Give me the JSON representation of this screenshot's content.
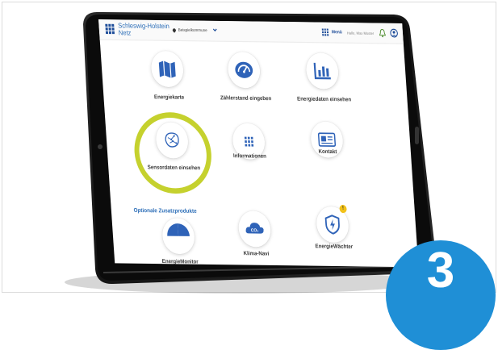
{
  "app": {
    "brand_line1": "Schleswig-Holstein",
    "brand_line2": "Netz",
    "location_label": "Beispielkommune",
    "menu_label": "Menü",
    "greeting": "Hallo, Max Muster"
  },
  "tiles": [
    {
      "label": "Energiekarte",
      "icon": "map-icon"
    },
    {
      "label": "Zählerstand eingeben",
      "icon": "gauge-icon"
    },
    {
      "label": "Energiedaten einsehen",
      "icon": "bar-chart-icon"
    },
    {
      "label": "Sensordaten einsehen",
      "icon": "sensor-brain-icon"
    },
    {
      "label": "Informationen",
      "icon": "grid-dots-icon"
    },
    {
      "label": "Kontakt",
      "icon": "contact-card-icon"
    }
  ],
  "optional_section": {
    "title": "Optionale Zusatzprodukte",
    "products": [
      {
        "label": "EnergieMonitor",
        "icon": "pie-icon"
      },
      {
        "label": "Klima-Navi",
        "icon": "co2-cloud-icon",
        "icon_text": "CO₂"
      },
      {
        "label": "EnergieWächter",
        "icon": "shield-bolt-icon",
        "badge": "!"
      }
    ]
  },
  "step_badge": "3",
  "colors": {
    "brand_blue": "#1f4e9a",
    "accent_blue": "#2e6fb8",
    "highlight_ring": "#c5d12e",
    "step_badge": "#1f8fd6",
    "tablet_body": "#1a1a1a"
  }
}
